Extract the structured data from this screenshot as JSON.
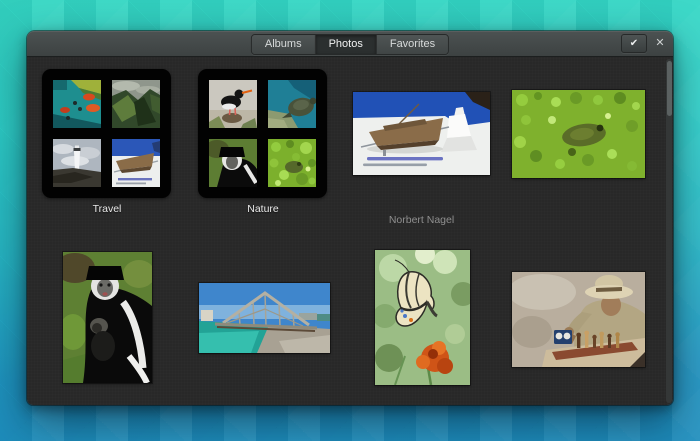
{
  "header": {
    "tabs": [
      {
        "label": "Albums",
        "active": false
      },
      {
        "label": "Photos",
        "active": true
      },
      {
        "label": "Favorites",
        "active": false
      }
    ],
    "select_button_icon": "✔",
    "close_button_icon": "✕"
  },
  "content": {
    "albums": [
      {
        "label": "Travel",
        "thumbnails": [
          "pool-scene",
          "canyon",
          "lighthouse",
          "model-boat"
        ]
      },
      {
        "label": "Nature",
        "thumbnails": [
          "oystercatcher-bird",
          "sea-turtle",
          "colobus-monkey",
          "duckweed"
        ]
      }
    ],
    "photos": [
      {
        "name": "model-boat-on-terrace",
        "caption": "Norbert Nagel"
      },
      {
        "name": "frog-in-duckweed",
        "caption": ""
      },
      {
        "name": "colobus-monkey-with-baby",
        "caption": ""
      },
      {
        "name": "steel-truss-bridge",
        "caption": ""
      },
      {
        "name": "swallowtail-butterfly-on-marigold",
        "caption": ""
      },
      {
        "name": "man-playing-chess",
        "caption": ""
      }
    ],
    "scrollbar_position": "top"
  },
  "colors": {
    "wallpaper_top": "#35d7c3",
    "wallpaper_bottom": "#1f8fc0",
    "titlebar": "#454b4b",
    "tab_active_bg": "#2b2f2f",
    "content_bg": "#282828",
    "album_collage_bg": "#020202",
    "label_text": "#e9e9e9",
    "caption_text": "#8f8f8f"
  }
}
